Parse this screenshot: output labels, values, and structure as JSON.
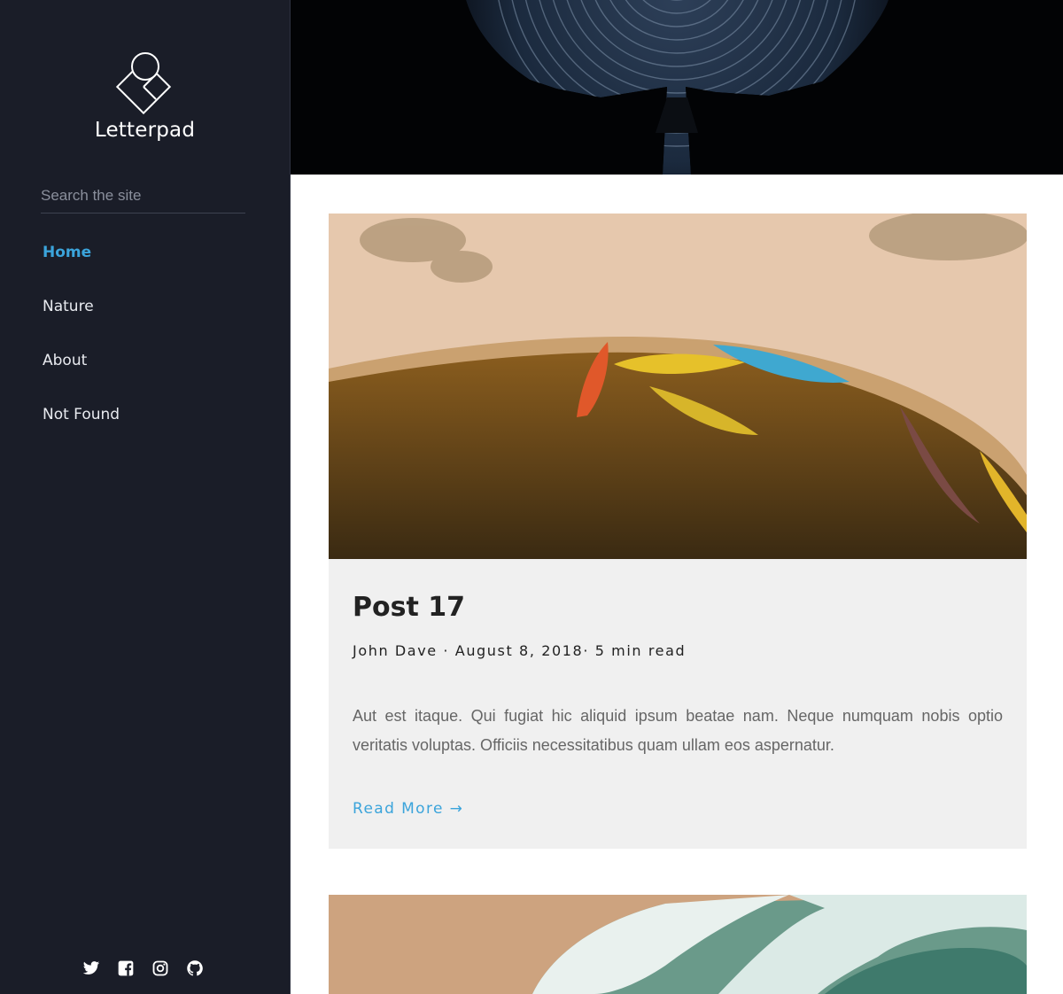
{
  "site": {
    "name": "Letterpad"
  },
  "search": {
    "placeholder": "Search the site"
  },
  "nav": {
    "items": [
      {
        "label": "Home",
        "active": true
      },
      {
        "label": "Nature",
        "active": false
      },
      {
        "label": "About",
        "active": false
      },
      {
        "label": "Not Found",
        "active": false
      }
    ]
  },
  "social": {
    "icons": [
      "twitter-icon",
      "facebook-icon",
      "instagram-icon",
      "github-icon"
    ]
  },
  "posts": [
    {
      "title": "Post 17",
      "meta": "John Dave · August 8, 2018· 5 min read",
      "excerpt": "Aut est itaque. Qui fugiat hic aliquid ipsum beatae nam. Neque numquam nobis optio veritatis voluptas. Officiis necessitatibus quam ullam eos aspernatur.",
      "read_more": "Read More →"
    }
  ],
  "colors": {
    "sidebar_bg": "#1a1d28",
    "accent": "#3ba4db",
    "card_bg": "#f0f0f0"
  }
}
